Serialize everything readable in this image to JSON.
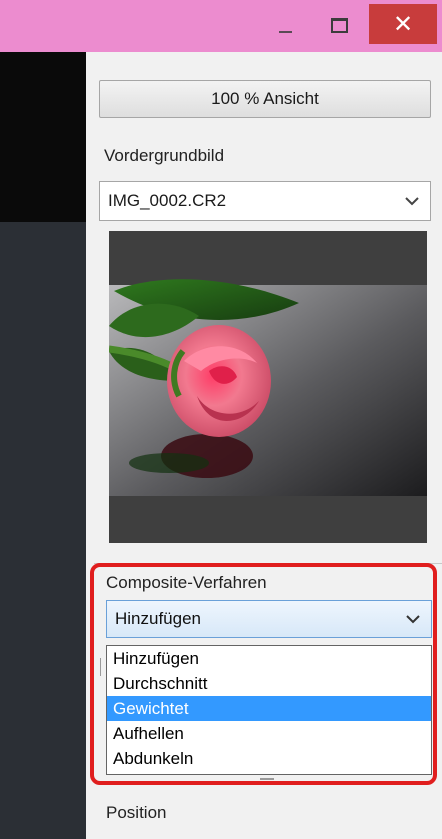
{
  "window_controls": {
    "minimize_icon": "minimize-icon",
    "maximize_icon": "maximize-icon",
    "close_icon": "close-icon",
    "close_glyph": "✕"
  },
  "panel": {
    "view_100_button": "100 % Ansicht",
    "foreground_label": "Vordergrundbild",
    "foreground_select_value": "IMG_0002.CR2",
    "composite_label": "Composite-Verfahren",
    "composite_select_value": "Hinzufügen",
    "composite_options": [
      "Hinzufügen",
      "Durchschnitt",
      "Gewichtet",
      "Aufhellen",
      "Abdunkeln"
    ],
    "composite_highlighted_option": "Gewichtet",
    "position_label": "Position"
  },
  "colors": {
    "titlebar": "#ec8ccf",
    "close_button": "#c83c3c",
    "highlight_border": "#e01e1e",
    "selection": "#3399ff"
  }
}
